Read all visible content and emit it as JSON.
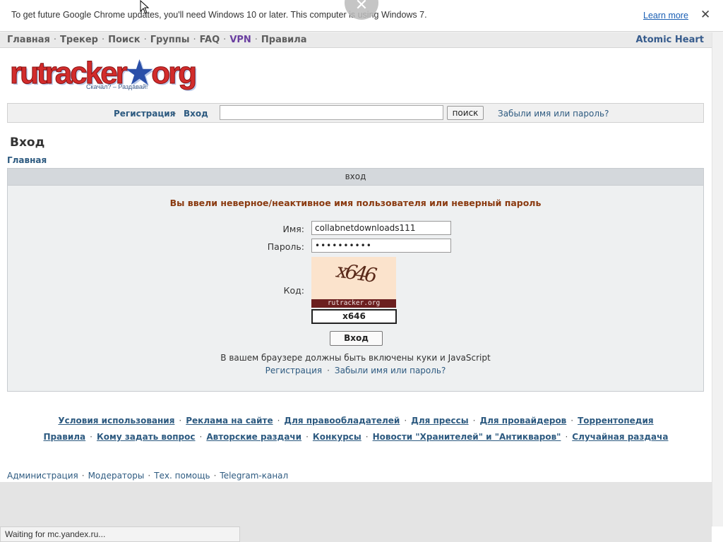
{
  "infobar": {
    "message": "To get future Google Chrome updates, you'll need Windows 10 or later. This computer is using Windows 7.",
    "learn_more": "Learn more",
    "close": "✕",
    "bubble_close": "✕"
  },
  "topnav": {
    "items": [
      "Главная",
      "Трекер",
      "Поиск",
      "Группы",
      "FAQ",
      "VPN",
      "Правила"
    ],
    "separator": "·",
    "right_link": "Atomic Heart"
  },
  "logo": {
    "text_main": "rutracker",
    "text_dot": "★",
    "text_end": "org",
    "tagline": "Скачал? – Раздавай!"
  },
  "loginbar": {
    "register": "Регистрация",
    "separator": "·",
    "login": "Вход",
    "search_button": "поиск",
    "forgot": "Забыли имя или пароль?"
  },
  "page": {
    "title": "Вход",
    "breadcrumb": "Главная"
  },
  "panel": {
    "header": "вход",
    "error": "Вы ввели неверное/неактивное имя пользователя или неверный пароль",
    "username_label": "Имя:",
    "username_value": "collabnetdownloads111",
    "password_label": "Пароль:",
    "password_value": "••••••••••",
    "code_label": "Код:",
    "captcha_text": "x646",
    "captcha_band": "rutracker.org",
    "code_value": "x646",
    "submit": "Вход",
    "note": "В вашем браузере должны быть включены куки и JavaScript",
    "link_register": "Регистрация",
    "link_separator": "·",
    "link_forgot": "Забыли имя или пароль?"
  },
  "footer": {
    "row1": [
      "Условия использования",
      "Реклама на сайте",
      "Для правообладателей",
      "Для прессы",
      "Для провайдеров",
      "Торрентопедия"
    ],
    "row2": [
      "Правила",
      "Кому задать вопрос",
      "Авторские раздачи",
      "Конкурсы",
      "Новости \"Хранителей\" и \"Антикваров\"",
      "Случайная раздача"
    ],
    "row3": [
      "Администрация",
      "Модераторы",
      "Тех. помощь",
      "Telegram-канал"
    ],
    "separator": "·"
  },
  "status": {
    "text": "Waiting for mc.yandex.ru..."
  }
}
